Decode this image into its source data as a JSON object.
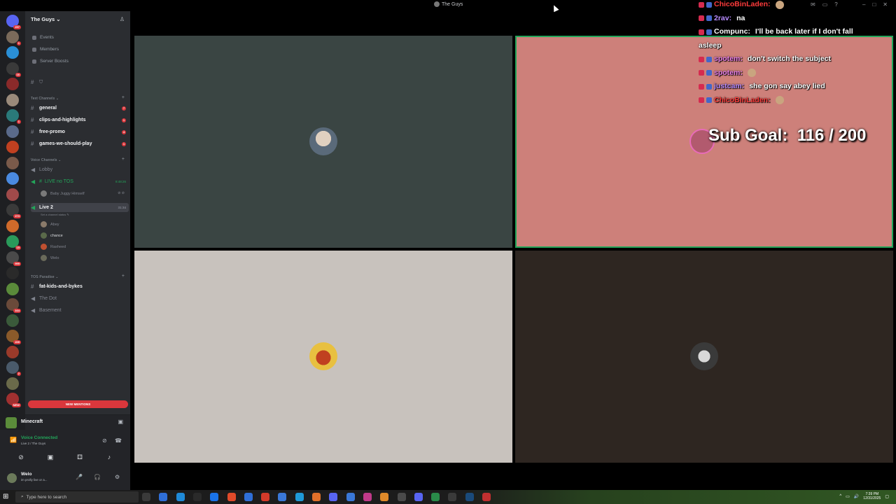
{
  "window": {
    "title": "The Guys"
  },
  "rail": {
    "servers": [
      {
        "name": "discord-home",
        "color": "#5865f2",
        "badge": "297"
      },
      {
        "name": "server-1",
        "color": "#7a6a5a",
        "badge": "1"
      },
      {
        "name": "server-2",
        "color": "#2a8fd6",
        "badge": ""
      },
      {
        "name": "server-3",
        "color": "#3a3a3a",
        "badge": "16"
      },
      {
        "name": "server-4",
        "color": "#8a2a2a",
        "badge": ""
      },
      {
        "name": "server-5",
        "color": "#9a8a7a",
        "badge": ""
      },
      {
        "name": "server-6",
        "color": "#2a7a7a",
        "badge": "1"
      },
      {
        "name": "server-7",
        "color": "#5a6a8a",
        "badge": ""
      },
      {
        "name": "server-8",
        "color": "#c04020",
        "badge": ""
      },
      {
        "name": "server-9",
        "color": "#7a5a4a",
        "badge": ""
      },
      {
        "name": "server-10",
        "color": "#4a8ae0",
        "badge": ""
      },
      {
        "name": "server-11",
        "color": "#a04a4a",
        "badge": ""
      },
      {
        "name": "server-12",
        "color": "#3a3a3a",
        "badge": "273"
      },
      {
        "name": "server-13",
        "color": "#d06a2a",
        "badge": ""
      },
      {
        "name": "server-14",
        "color": "#2a9a5a",
        "badge": "15"
      },
      {
        "name": "server-15",
        "color": "#4a4a4a",
        "badge": "999"
      },
      {
        "name": "server-16",
        "color": "#2a2a2a",
        "badge": ""
      },
      {
        "name": "server-17",
        "color": "#5a8a3a",
        "badge": ""
      },
      {
        "name": "server-18",
        "color": "#6a4a3a",
        "badge": "164"
      },
      {
        "name": "server-19",
        "color": "#3a5a3a",
        "badge": ""
      },
      {
        "name": "server-20",
        "color": "#8a5a2a",
        "badge": "209"
      },
      {
        "name": "server-21",
        "color": "#9a3a2a",
        "badge": ""
      },
      {
        "name": "server-22",
        "color": "#4a5a6a",
        "badge": "2"
      },
      {
        "name": "server-23",
        "color": "#6a6a4a",
        "badge": ""
      },
      {
        "name": "server-24",
        "color": "#a03030",
        "badge": "NEW"
      }
    ]
  },
  "sidebar": {
    "server_name": "The Guys",
    "nav": {
      "events": "Events",
      "members": "Members",
      "boosts": "Server Boosts"
    },
    "text_category": "Text Channels",
    "text_channels": [
      {
        "name": "general",
        "unread": "7"
      },
      {
        "name": "clips-and-highlights",
        "unread": "1"
      },
      {
        "name": "free-promo",
        "unread": "4"
      },
      {
        "name": "games-we-should-play",
        "unread": "1"
      }
    ],
    "voice_category": "Voice Channels",
    "lobby": "Lobby",
    "live_tos": {
      "name": "LIVE no TOS",
      "timer": "8:48:26",
      "member": "Baby Juggy Himself"
    },
    "live2": {
      "name": "Live 2",
      "timer": "31:34",
      "status_hint": "Set a channel status"
    },
    "live2_members": [
      {
        "name": "Abey",
        "color": "#8a7a6a",
        "active": false
      },
      {
        "name": "chance",
        "color": "#5a6a4a",
        "active": true
      },
      {
        "name": "Rasheed",
        "color": "#c05030",
        "active": false
      },
      {
        "name": "Welo",
        "color": "#6a6a5a",
        "active": false
      }
    ],
    "tos_category": "TOS Paradise",
    "tos_channels": {
      "fat_kids": "fat-kids-and-bykes",
      "the_dot": "The Dot",
      "basement": "Basement"
    },
    "new_mentions": "NEW MENTIONS"
  },
  "activity": {
    "game": "Minecraft"
  },
  "voice": {
    "status": "Voice Connected",
    "location": "Live 2 / The Guys"
  },
  "user": {
    "name": "Welo",
    "status": "im prolly live or a..."
  },
  "chat": [
    {
      "user": "ChicoBinLaden",
      "msg": "",
      "user_color": "#ff3b3b"
    },
    {
      "user": "2rav",
      "msg": "na",
      "user_color": "#b88cff"
    },
    {
      "user": "Compunc",
      "msg": "I'll be back later if I don't fall",
      "user_color": "#ffffff"
    },
    {
      "user": "",
      "msg": "asleep",
      "user_color": "#ffffff"
    },
    {
      "user": "spotem",
      "msg": "don't switch the subject",
      "user_color": "#e87fe8"
    },
    {
      "user": "spotem",
      "msg": "",
      "user_color": "#e87fe8"
    },
    {
      "user": "justcam",
      "msg": "she gon say abey lied",
      "user_color": "#b88cff"
    },
    {
      "user": "ChicoBinLaden",
      "msg": "",
      "user_color": "#ff3b3b"
    }
  ],
  "sub_goal": {
    "label": "Sub Goal:",
    "value": "116 / 200"
  },
  "taskbar": {
    "search_placeholder": "Type here to search",
    "time": "7:39 PM",
    "date": "12/31/2025"
  }
}
